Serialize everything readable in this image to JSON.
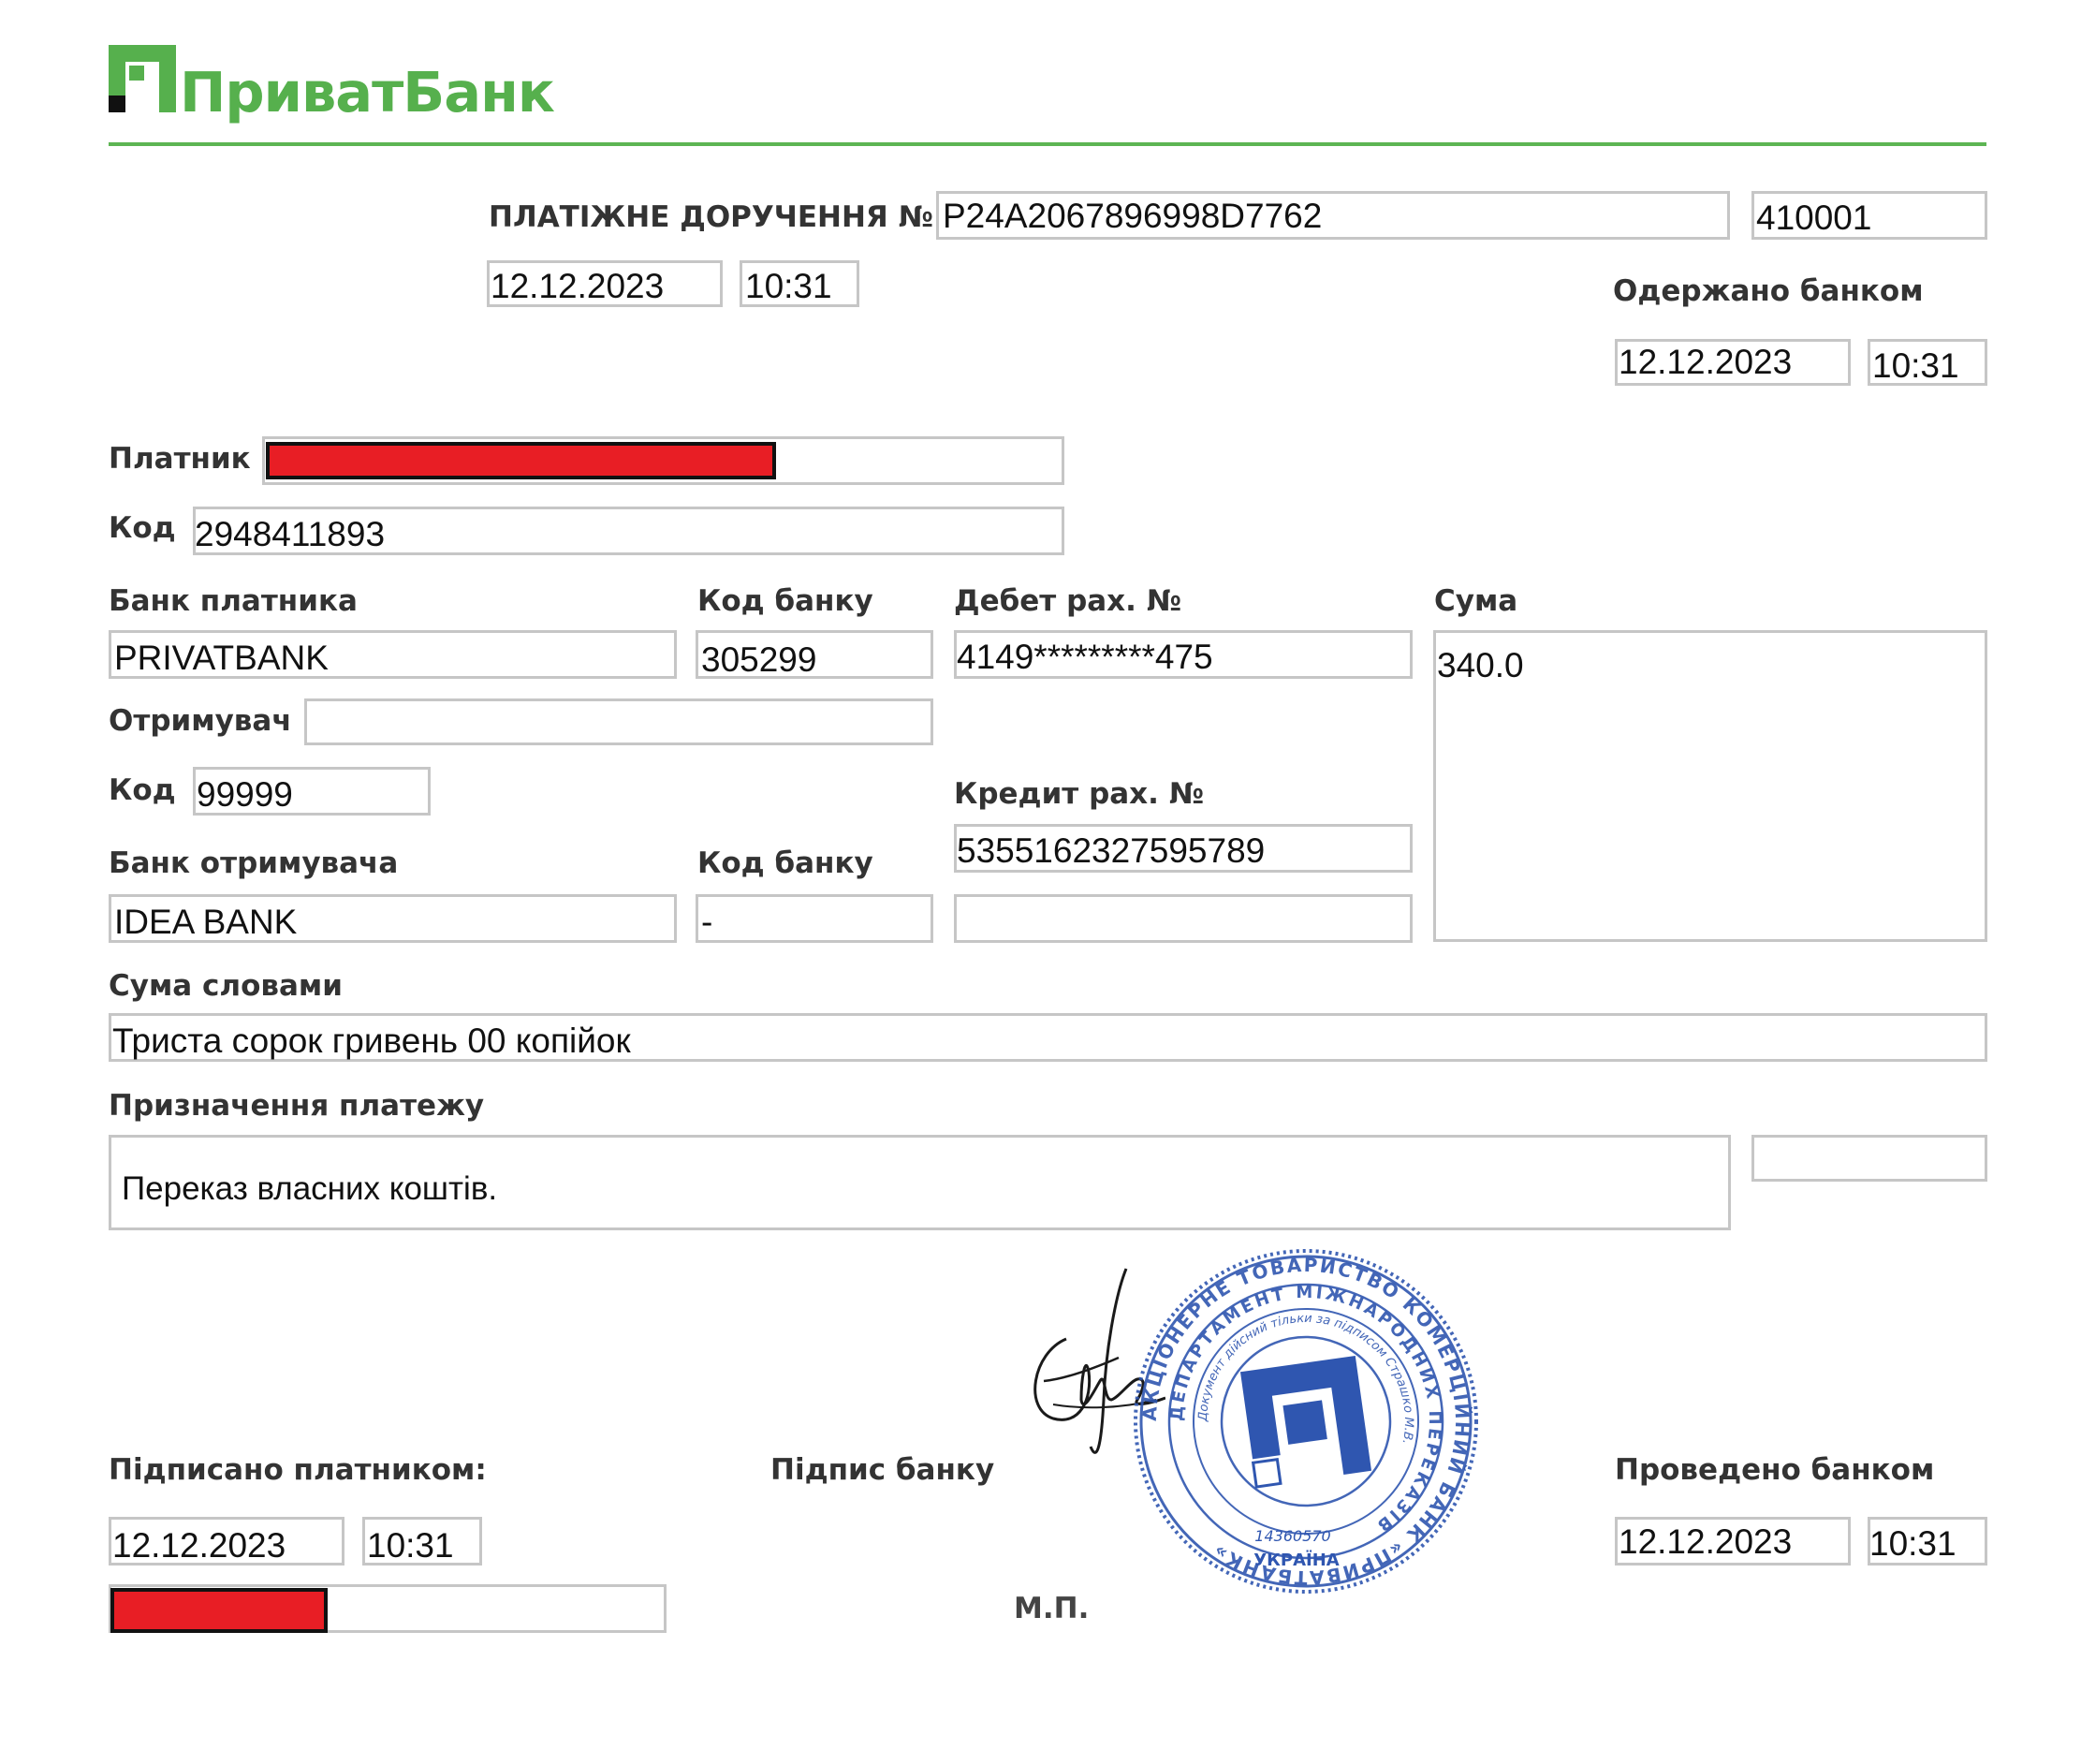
{
  "bank": {
    "logo_text": "ПриватБанк",
    "brand_color": "#5db553"
  },
  "document": {
    "title": "ПЛАТІЖНЕ ДОРУЧЕННЯ №",
    "number": "P24A2067896998D7762",
    "code": "410001",
    "date": "12.12.2023",
    "time": "10:31"
  },
  "received": {
    "label": "Одержано банком",
    "date": "12.12.2023",
    "time": "10:31"
  },
  "payer": {
    "label": "Платник",
    "code_label": "Код",
    "code": "2948411893",
    "bank_label": "Банк платника",
    "bank": "PRIVATBANK",
    "bank_code_label": "Код банку",
    "bank_code": "305299",
    "debit_label": "Дебет рах. №",
    "debit_account": "4149*********475"
  },
  "amount": {
    "label": "Сума",
    "value": "340.0"
  },
  "recipient": {
    "label": "Отримувач",
    "code_label": "Код",
    "code": "99999",
    "bank_label": "Банк отримувача",
    "bank": "IDEA BANK",
    "bank_code_label": "Код банку",
    "bank_code": "-",
    "credit_label": "Кредит рах. №",
    "credit_account": "5355162327595789"
  },
  "amount_words": {
    "label": "Сума словами",
    "value": "Триста сорок гривень 00 копійок"
  },
  "purpose": {
    "label": "Призначення платежу",
    "value": "Переказ власних коштів."
  },
  "signatures": {
    "signed_label": "Підписано платником:",
    "signed_date": "12.12.2023",
    "signed_time": "10:31",
    "bank_sign_label": "Підпис банку",
    "mp_label": "М.П.",
    "processed_label": "Проведено банком",
    "processed_date": "12.12.2023",
    "processed_time": "10:31"
  },
  "stamp": {
    "outer_text": "АКЦІОНЕРНЕ ТОВАРИСТВО КОМЕРЦІЙНИЙ БАНК «ПРИВАТБАНК»",
    "middle_text": "ДЕПАРТАМЕНТ МІЖНАРОДНИХ ПЕРЕКАЗІВ",
    "inner_text": "Документ дійсний тільки за підписом Страшко М.В.",
    "code": "14360570",
    "country": "УКРАЇНА",
    "color": "#2f56b0"
  }
}
